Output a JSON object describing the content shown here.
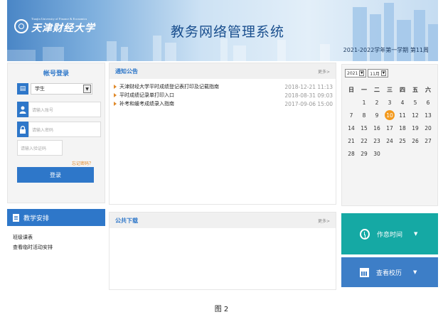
{
  "header": {
    "logo_en": "Tianjin University of Finance & Economics",
    "logo_cn": "天津财经大学",
    "system_title": "教务网络管理系统",
    "semester": "2021-2022学年第一学期 第11周"
  },
  "login": {
    "title": "帐号登录",
    "role_value": "学生",
    "account_placeholder": "请输入账号",
    "password_placeholder": "请输入密码",
    "captcha_placeholder": "请输入验证码",
    "forgot_label": "忘记密码？",
    "submit_label": "登录"
  },
  "teaching": {
    "title": "教学安排",
    "items": [
      "班级课表",
      "查看临时活动安排"
    ]
  },
  "notices": {
    "title": "通知公告",
    "more_label": "更多>",
    "items": [
      {
        "text": "天津财经大学平时成绩登记表打印及记载指南",
        "date": "2018-12-21 11:13"
      },
      {
        "text": "平时成绩记录单打印入口",
        "date": "2018-08-31 09:03"
      },
      {
        "text": "补考和缓考成绩录入指南",
        "date": "2017-09-06 15:00"
      }
    ]
  },
  "downloads": {
    "title": "公共下载",
    "more_label": "更多>"
  },
  "calendar": {
    "year_value": "2021",
    "month_value": "11月",
    "weekdays": [
      "日",
      "一",
      "二",
      "三",
      "四",
      "五",
      "六"
    ],
    "days": [
      "",
      "1",
      "2",
      "3",
      "4",
      "5",
      "6",
      "7",
      "8",
      "9",
      "10",
      "11",
      "12",
      "13",
      "14",
      "15",
      "16",
      "17",
      "18",
      "19",
      "20",
      "21",
      "22",
      "23",
      "24",
      "25",
      "26",
      "27",
      "28",
      "29",
      "30"
    ],
    "today": "10",
    "highlight_color": "#f39a1e"
  },
  "tiles": {
    "schedule_label": "作息时间",
    "school_calendar_label": "查看校历",
    "teal_color": "#15a9a4",
    "blue_color": "#3d7ec7"
  },
  "caption": "图 2"
}
